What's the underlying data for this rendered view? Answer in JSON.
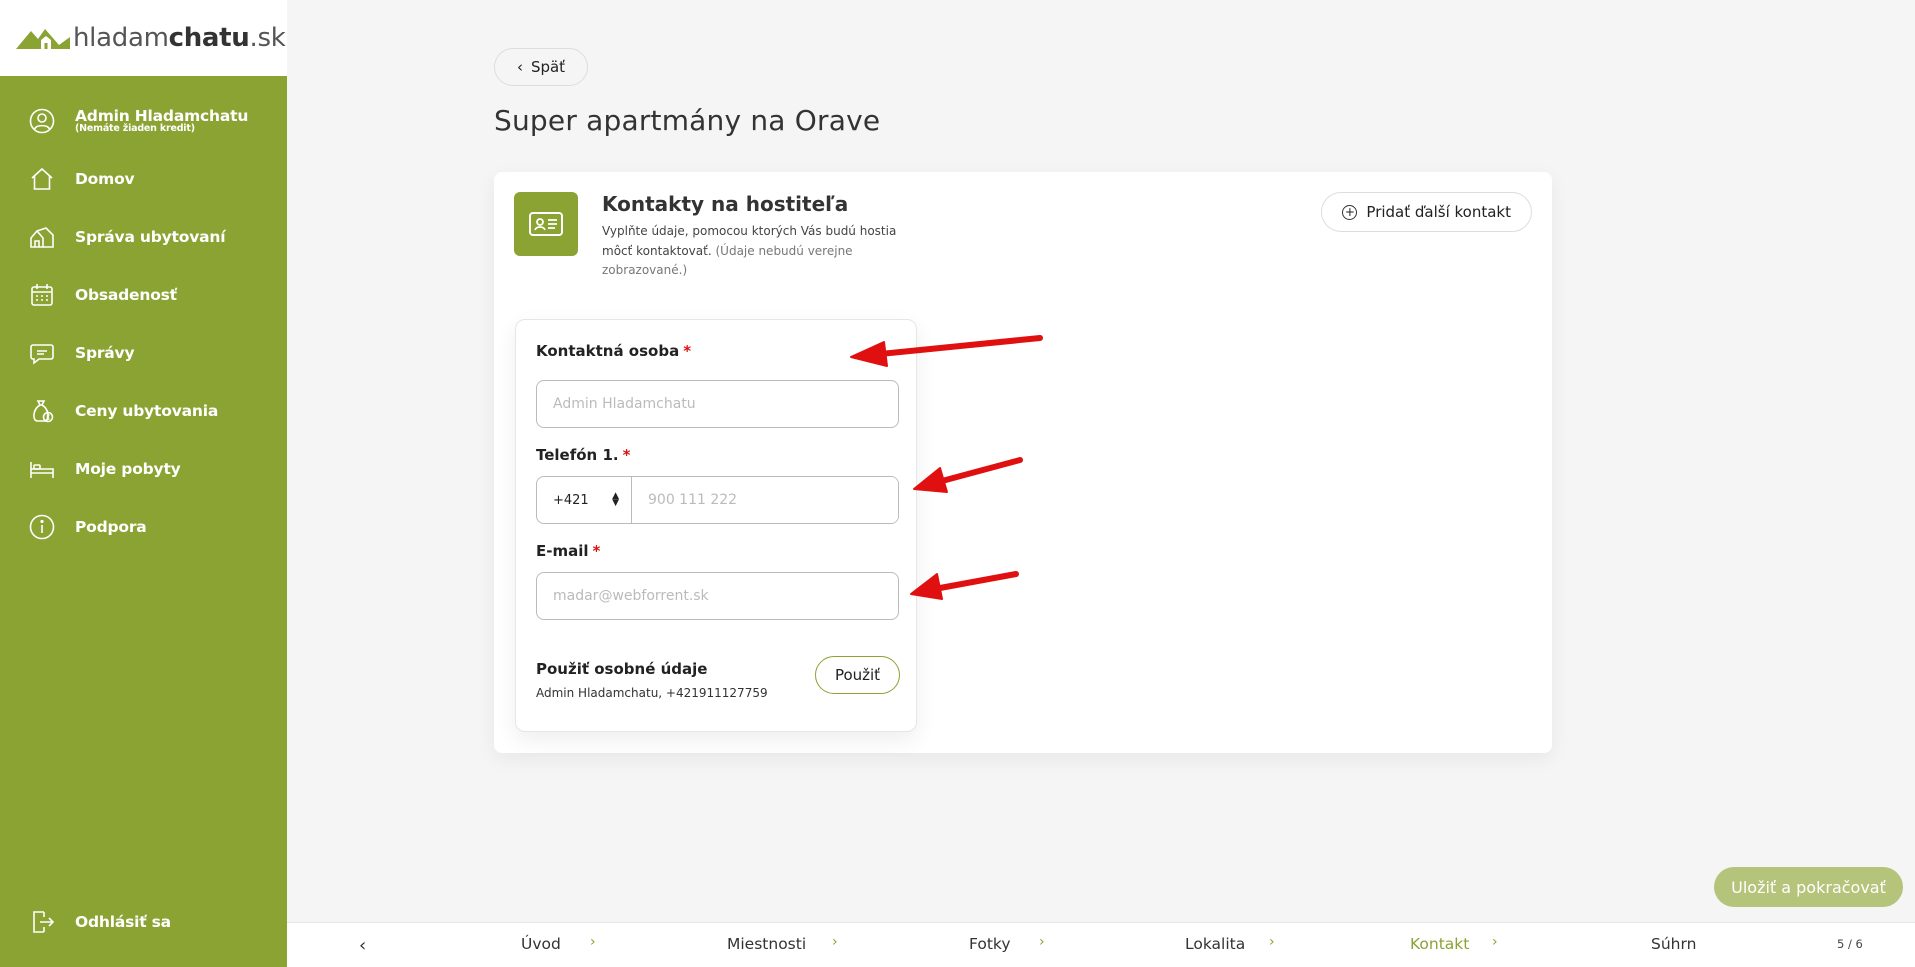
{
  "logo": {
    "part1": "hladam",
    "part2": "chatu",
    "part3": ".sk"
  },
  "sidebar": {
    "user": {
      "name": "Admin Hladamchatu",
      "sub": "(Nemáte žiaden kredit)"
    },
    "items": [
      {
        "label": "Domov"
      },
      {
        "label": "Správa ubytovaní"
      },
      {
        "label": "Obsadenosť"
      },
      {
        "label": "Správy"
      },
      {
        "label": "Ceny ubytovania"
      },
      {
        "label": "Moje pobyty"
      },
      {
        "label": "Podpora"
      }
    ],
    "logout": "Odhlásiť sa"
  },
  "header": {
    "back_label": "Späť",
    "title": "Super apartmány na Orave"
  },
  "card": {
    "title": "Kontakty na hostiteľa",
    "desc_main": "Vyplňte údaje, pomocou ktorých Vás budú hostia môcť kontaktovať.",
    "desc_muted": "(Údaje nebudú verejne zobrazované.)",
    "add_contact": "Pridať ďalší kontakt"
  },
  "form": {
    "contact_label": "Kontaktná osoba",
    "contact_placeholder": "Admin Hladamchatu",
    "phone_label": "Telefón 1.",
    "phone_prefix": "+421",
    "phone_placeholder": "900 111 222",
    "email_label": "E-mail",
    "email_placeholder": "madar@webforrent.sk",
    "required_mark": "*",
    "use_title": "Použiť osobné údaje",
    "use_info": "Admin Hladamchatu, +421911127759",
    "use_button": "Použiť"
  },
  "save_button": "Uložiť a pokračovať",
  "steps": {
    "items": [
      "Úvod",
      "Miestnosti",
      "Fotky",
      "Lokalita",
      "Kontakt",
      "Súhrn"
    ],
    "active_index": 4,
    "counter": "5 / 6"
  },
  "colors": {
    "brand": "#8aa332",
    "save_disabled": "#b4c47a",
    "required": "#dd1111",
    "arrow": "#e01010"
  }
}
